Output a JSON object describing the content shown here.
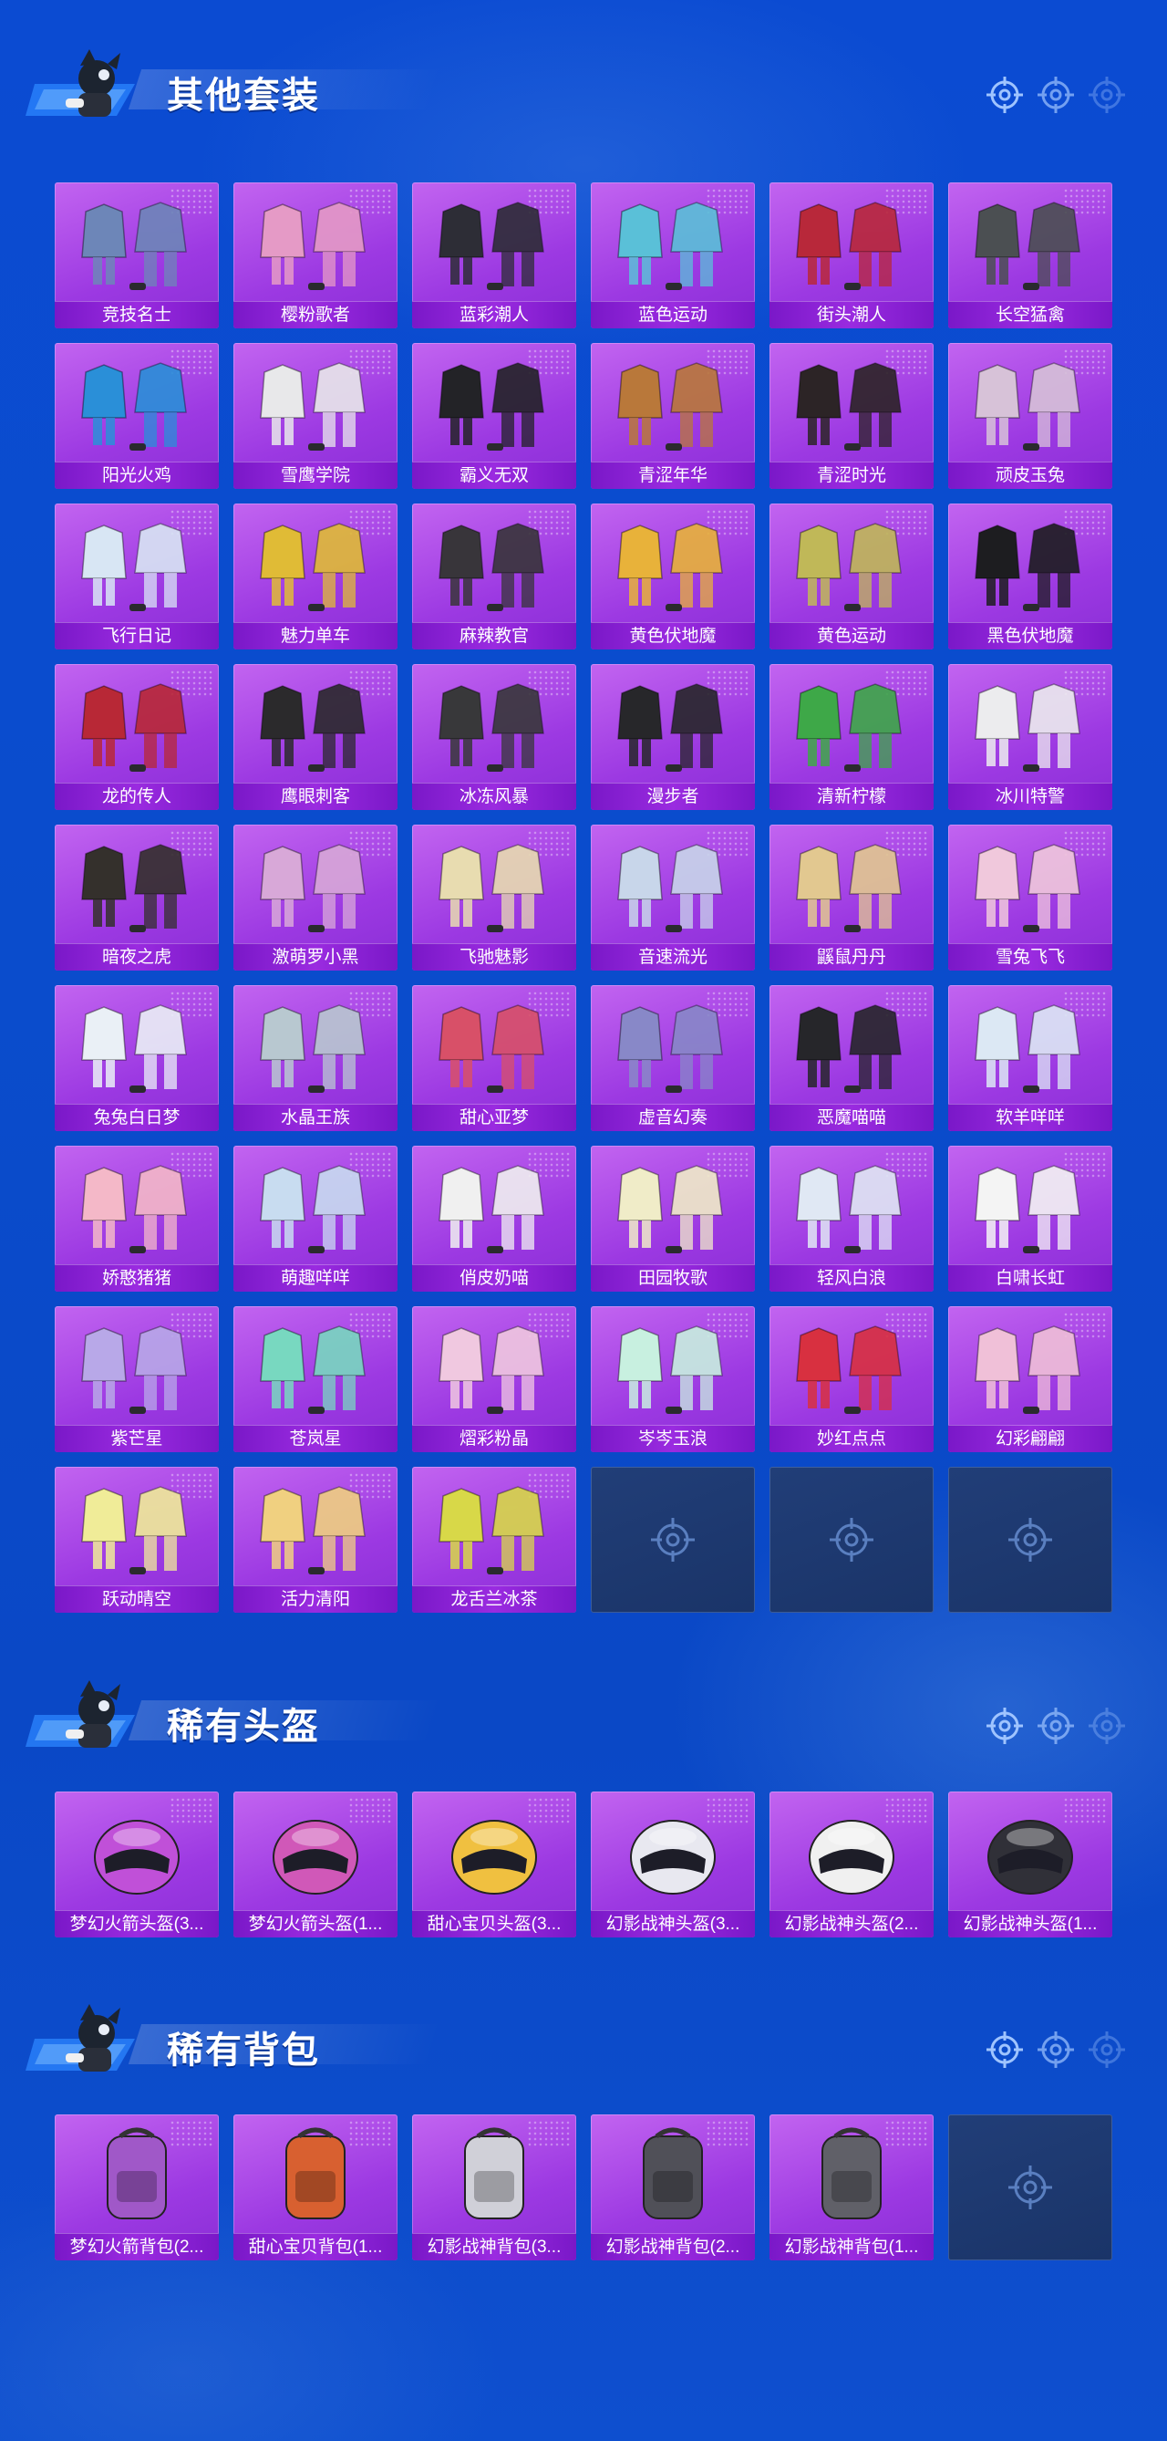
{
  "sections": [
    {
      "title": "其他套装",
      "items": [
        {
          "name": "竞技名士",
          "color": "#6d86b8"
        },
        {
          "name": "樱粉歌者",
          "color": "#e59ac6"
        },
        {
          "name": "蓝彩潮人",
          "color": "#2d2d36"
        },
        {
          "name": "蓝色运动",
          "color": "#5ac0d8"
        },
        {
          "name": "街头潮人",
          "color": "#b8283a"
        },
        {
          "name": "长空猛禽",
          "color": "#4b4f52"
        },
        {
          "name": "阳光火鸡",
          "color": "#2a8fd8"
        },
        {
          "name": "雪鹰学院",
          "color": "#e8e8ea"
        },
        {
          "name": "霸义无双",
          "color": "#232327"
        },
        {
          "name": "青涩年华",
          "color": "#b9783a"
        },
        {
          "name": "青涩时光",
          "color": "#2c2426"
        },
        {
          "name": "顽皮玉兔",
          "color": "#d7c2d8"
        },
        {
          "name": "飞行日记",
          "color": "#d8e6f4"
        },
        {
          "name": "魅力单车",
          "color": "#e0bb36"
        },
        {
          "name": "麻辣教官",
          "color": "#38353a"
        },
        {
          "name": "黄色伏地魔",
          "color": "#e8b23a"
        },
        {
          "name": "黄色运动",
          "color": "#c0b858"
        },
        {
          "name": "黑色伏地魔",
          "color": "#1d1d20"
        },
        {
          "name": "龙的传人",
          "color": "#b82836"
        },
        {
          "name": "鹰眼刺客",
          "color": "#2b2a2c"
        },
        {
          "name": "冰冻风暴",
          "color": "#38383a"
        },
        {
          "name": "漫步者",
          "color": "#27272a"
        },
        {
          "name": "清新柠檬",
          "color": "#3ea848"
        },
        {
          "name": "冰川特警",
          "color": "#ececee"
        },
        {
          "name": "暗夜之虎",
          "color": "#34302c"
        },
        {
          "name": "激萌罗小黑",
          "color": "#d8a8d8"
        },
        {
          "name": "飞驰魅影",
          "color": "#e8dcb0"
        },
        {
          "name": "音速流光",
          "color": "#c8d6ea"
        },
        {
          "name": "鼷鼠丹丹",
          "color": "#e2c890"
        },
        {
          "name": "雪兔飞飞",
          "color": "#f0c8dc"
        },
        {
          "name": "兔兔白日梦",
          "color": "#eaf0f6"
        },
        {
          "name": "水晶王族",
          "color": "#b8c8d0"
        },
        {
          "name": "甜心亚梦",
          "color": "#d85068"
        },
        {
          "name": "虚音幻奏",
          "color": "#8888c8"
        },
        {
          "name": "恶魔喵喵",
          "color": "#26262a"
        },
        {
          "name": "软羊咩咩",
          "color": "#dce8f4"
        },
        {
          "name": "娇憨猪猪",
          "color": "#f4b8c8"
        },
        {
          "name": "萌趣咩咩",
          "color": "#c8dcf0"
        },
        {
          "name": "俏皮奶喵",
          "color": "#f0f0f0"
        },
        {
          "name": "田园牧歌",
          "color": "#f0ecc8"
        },
        {
          "name": "轻风白浪",
          "color": "#e0e8f4"
        },
        {
          "name": "白啸长虹",
          "color": "#f4f4f4"
        },
        {
          "name": "紫芒星",
          "color": "#b8a8e8"
        },
        {
          "name": "苍岚星",
          "color": "#78d8c0"
        },
        {
          "name": "熠彩粉晶",
          "color": "#f0c8e0"
        },
        {
          "name": "岑岑玉浪",
          "color": "#c8f0e0"
        },
        {
          "name": "妙红点点",
          "color": "#d83040"
        },
        {
          "name": "幻彩翩翩",
          "color": "#f0c0d8"
        },
        {
          "name": "跃动晴空",
          "color": "#f0ec98"
        },
        {
          "name": "活力清阳",
          "color": "#f0d080"
        },
        {
          "name": "龙舌兰冰茶",
          "color": "#d8d848"
        },
        {
          "name": "",
          "empty": true
        },
        {
          "name": "",
          "empty": true
        },
        {
          "name": "",
          "empty": true
        }
      ]
    },
    {
      "title": "稀有头盔",
      "items": [
        {
          "name": "梦幻火箭头盔(3...",
          "color": "#c050d8"
        },
        {
          "name": "梦幻火箭头盔(1...",
          "color": "#d058b8"
        },
        {
          "name": "甜心宝贝头盔(3...",
          "color": "#f0c040"
        },
        {
          "name": "幻影战神头盔(3...",
          "color": "#e8e8f0"
        },
        {
          "name": "幻影战神头盔(2...",
          "color": "#f0f0f0"
        },
        {
          "name": "幻影战神头盔(1...",
          "color": "#303038"
        }
      ]
    },
    {
      "title": "稀有背包",
      "items": [
        {
          "name": "梦幻火箭背包(2...",
          "color": "#a058c8"
        },
        {
          "name": "甜心宝贝背包(1...",
          "color": "#d86030"
        },
        {
          "name": "幻影战神背包(3...",
          "color": "#d0d0d8"
        },
        {
          "name": "幻影战神背包(2...",
          "color": "#505058"
        },
        {
          "name": "幻影战神背包(1...",
          "color": "#606068"
        },
        {
          "name": "",
          "empty": true
        }
      ]
    }
  ],
  "icons": {
    "mascot": "mascot-icon",
    "crosshair": "crosshair-icon"
  }
}
